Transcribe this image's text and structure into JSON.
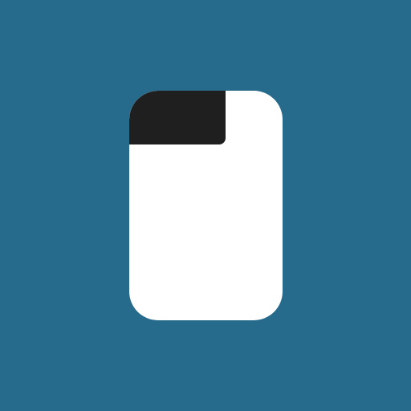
{
  "background_color": "#276b8c",
  "icon": {
    "name": "document-page-icon",
    "fill_color": "#ffffff",
    "corner_color": "#1f1f1f"
  }
}
